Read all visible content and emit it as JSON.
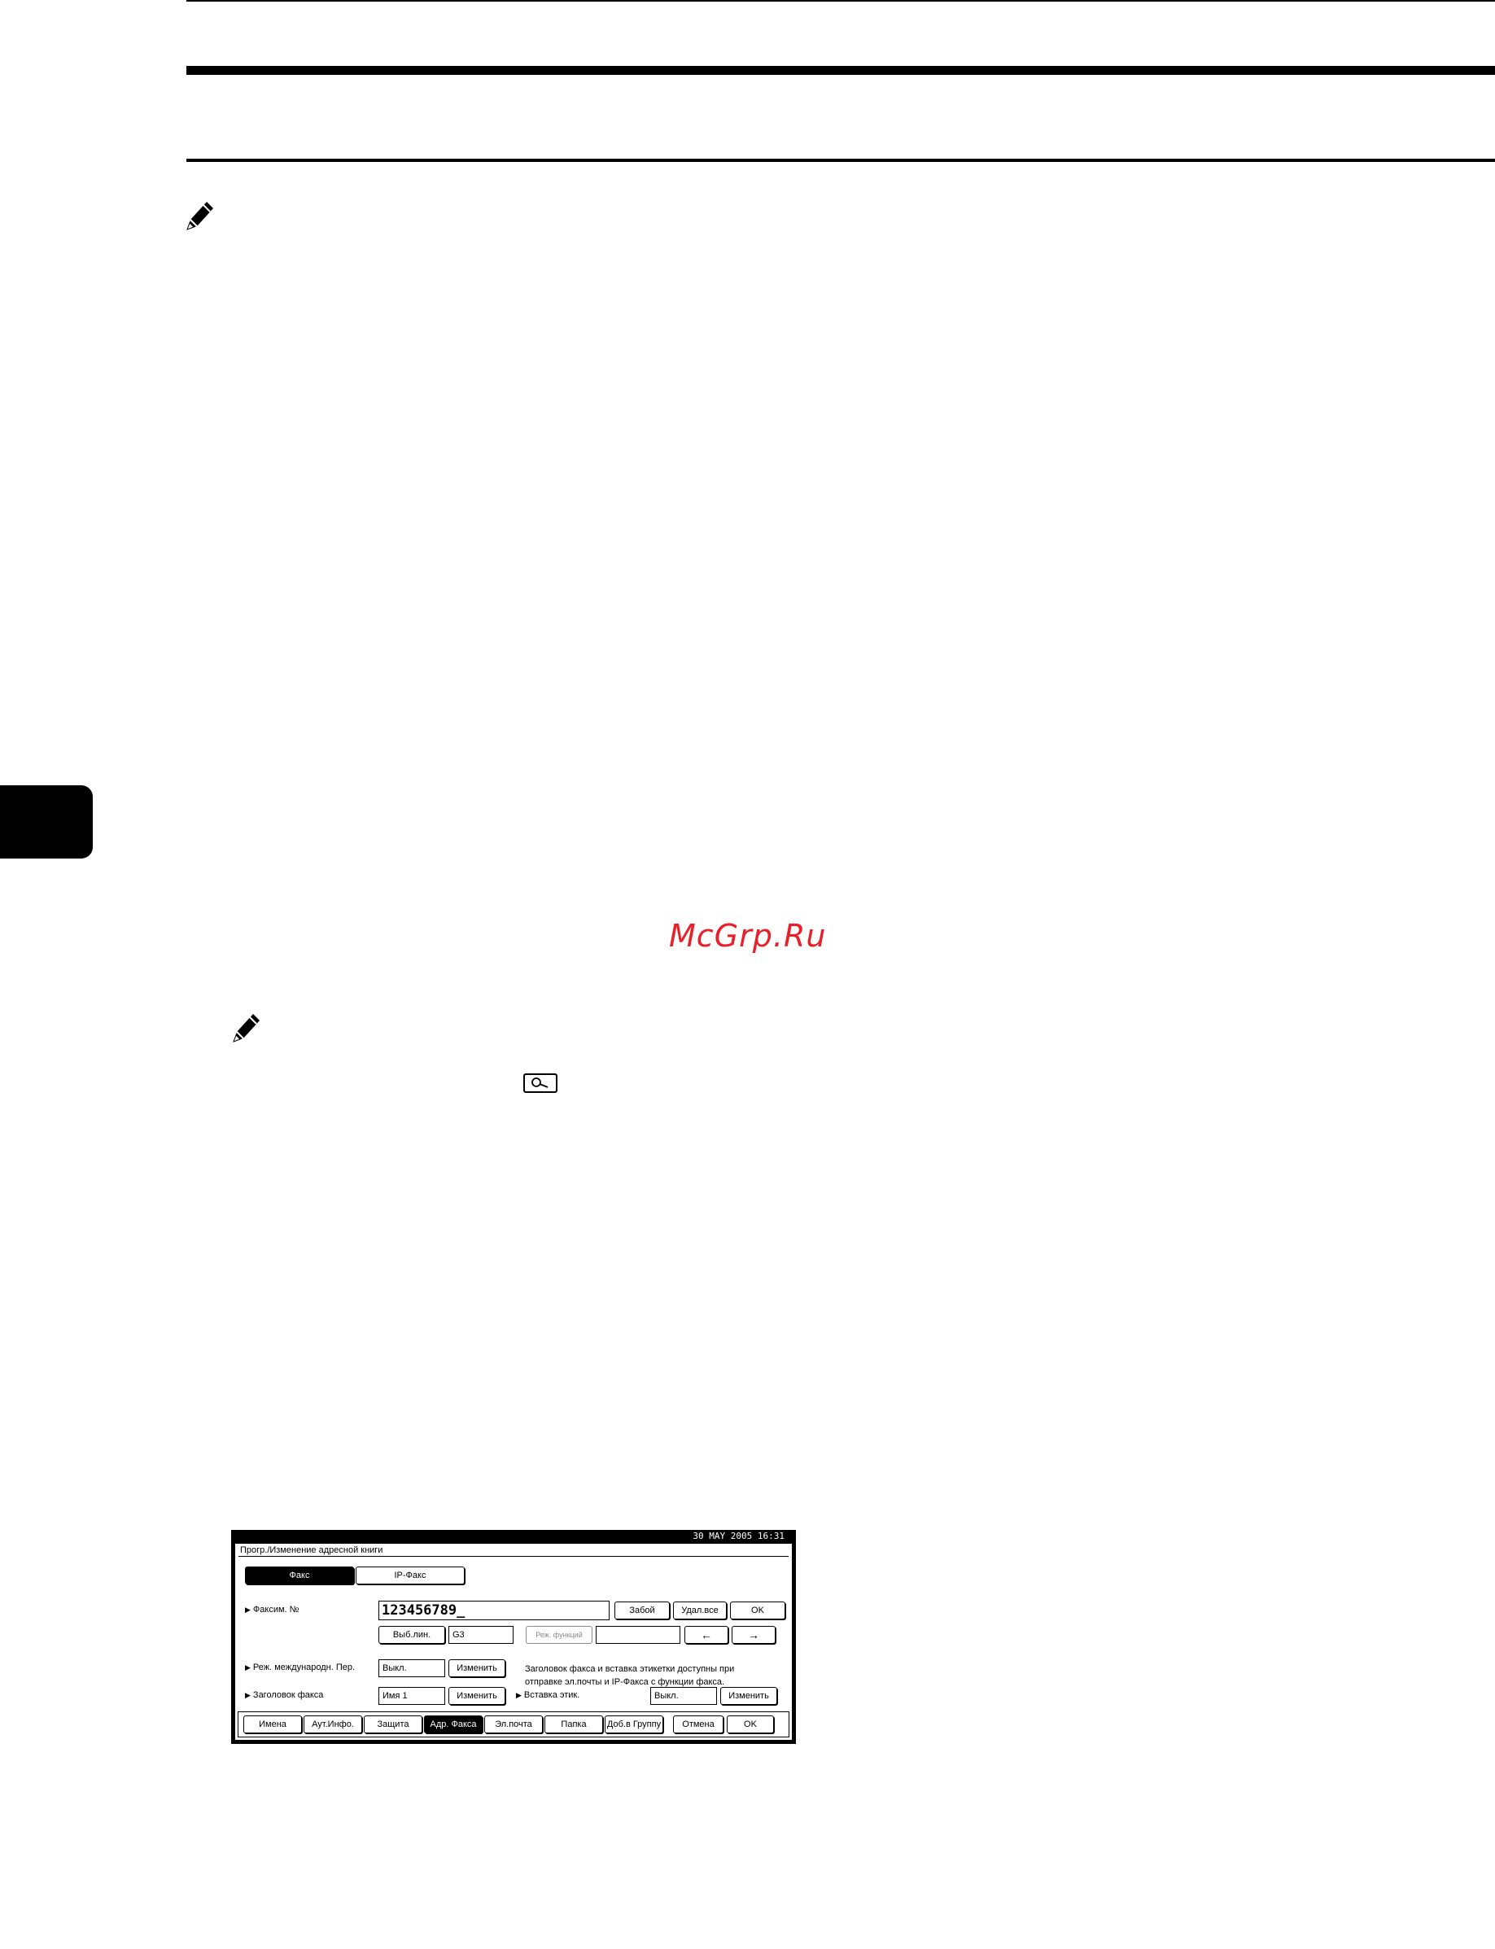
{
  "page": {
    "watermark": "McGrp.Ru"
  },
  "screenshot": {
    "status_datetime": "30 MAY 2005 16:31",
    "window_title": "Прогр./Изменение адресной книги",
    "tabs": {
      "fax": "Факс",
      "ip_fax": "IP-Факс"
    },
    "fax_number": {
      "label": "Факсим. №",
      "value": "123456789_",
      "pause_label": "Забой",
      "delete_all_label": "Удал.все",
      "ok_label": "OK",
      "line_select_label": "Выб.лин.",
      "line_value": "G3",
      "subcode_label": "Реж. функций",
      "subcode_value": "",
      "left_arrow": "←",
      "right_arrow": "→"
    },
    "intl_mode": {
      "label": "Реж. международн. Пер.",
      "value": "Выкл.",
      "change_label": "Изменить"
    },
    "fax_header": {
      "label": "Заголовок факса",
      "value": "Имя 1",
      "change_label": "Изменить"
    },
    "hint": {
      "line1": "Заголовок факса и вставка этикетки доступны при",
      "line2": "отправке эл.почты и IP-Факса с функции факса."
    },
    "label_insert": {
      "label": "Вставка этик.",
      "value": "Выкл.",
      "change_label": "Изменить"
    },
    "bottom_tabs": [
      "Имена",
      "Аут.Инфо.",
      "Защита",
      "Адр. Факса",
      "Эл.почта",
      "Папка",
      "Доб.в Группу"
    ],
    "cancel_label": "Отмена",
    "final_ok_label": "OK"
  }
}
